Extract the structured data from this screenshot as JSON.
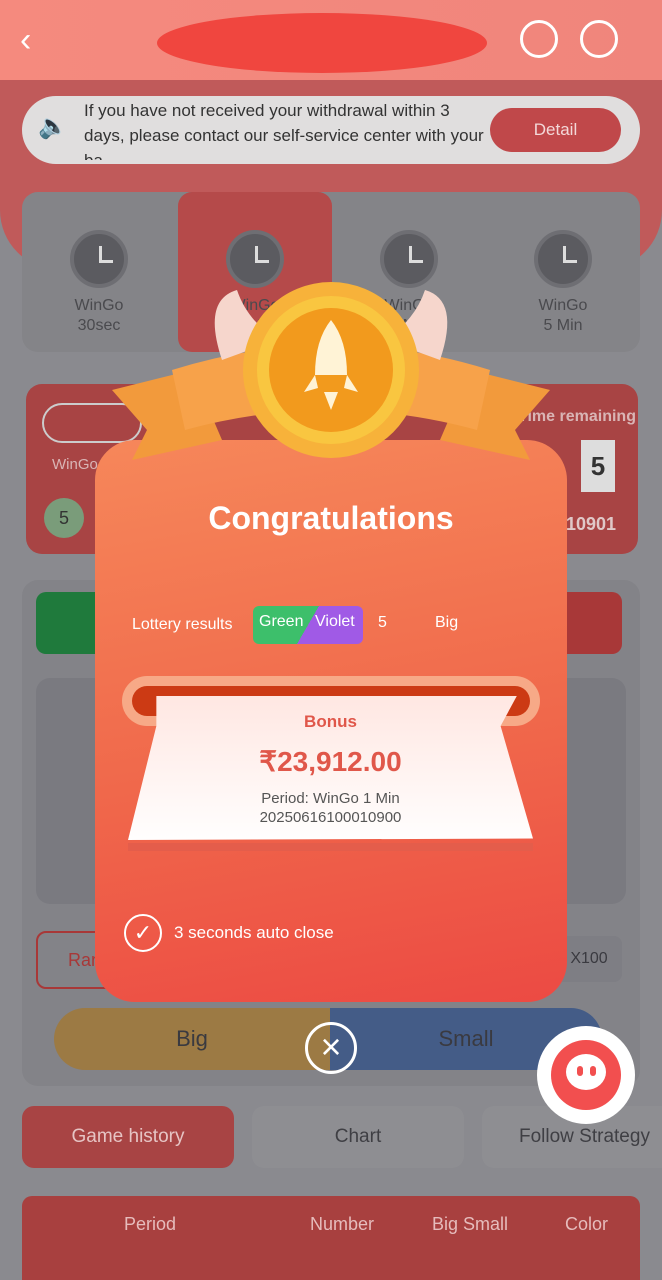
{
  "header": {
    "back_icon": "chevron-left-icon",
    "support_icon": "headset-icon",
    "music_icon": "music-note-icon"
  },
  "notice": {
    "text": "If you have not received your withdrawal within 3 days, please contact our self-service center with your ba",
    "button": "Detail"
  },
  "game_tabs": [
    {
      "label": "WinGo 30sec"
    },
    {
      "label": "WinGo 1 Min"
    },
    {
      "label": "WinGo 3 Min"
    },
    {
      "label": "WinGo 5 Min"
    }
  ],
  "background": {
    "card_left_label": "WinGo",
    "card_right_label": "Time remaining",
    "card_digit": "5",
    "card_issue": "10901",
    "ball_number": "5",
    "random_label": "Random",
    "multiplier": "X100",
    "big_label": "Big",
    "small_label": "Small"
  },
  "bottom_tabs": [
    "Game history",
    "Chart",
    "Follow Strategy"
  ],
  "table_headers": [
    "Period",
    "Number",
    "Big Small",
    "Color"
  ],
  "modal": {
    "title": "Congratulations",
    "lottery_label": "Lottery results",
    "color1": "Green",
    "color2": "Violet",
    "number": "5",
    "size": "Big",
    "bonus_label": "Bonus",
    "amount": "₹23,912.00",
    "period_line": "Period: WinGo 1 Min",
    "period_id": "20250616100010900",
    "auto_close": "3 seconds auto close"
  },
  "colors": {
    "accent": "#f0684b",
    "green": "#3dbf6b",
    "violet": "#a05ae6"
  }
}
